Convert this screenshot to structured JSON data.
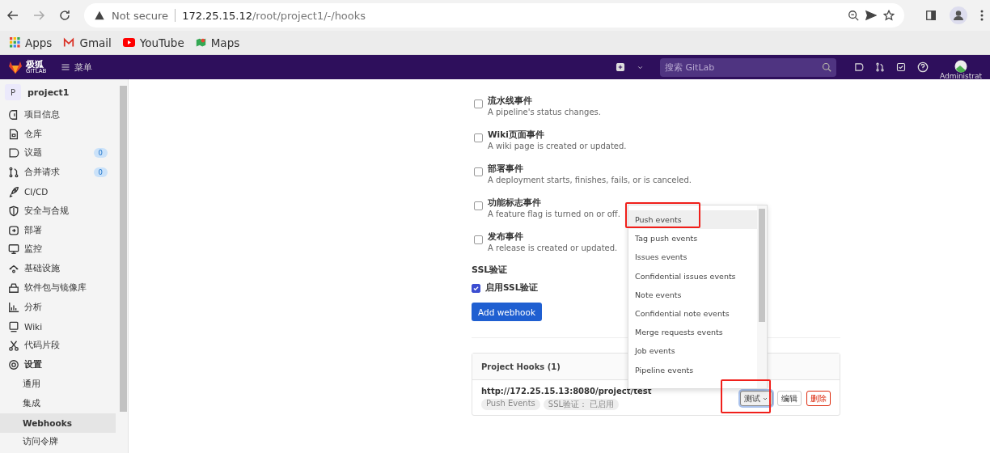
{
  "browser": {
    "security": "Not secure",
    "url_host": "172.25.15.12",
    "url_path": "/root/project1/-/hooks",
    "bookmarks": [
      "Apps",
      "Gmail",
      "YouTube",
      "Maps"
    ]
  },
  "header": {
    "brand": "极狐",
    "brand_sub": "GITLAB",
    "menu": "菜单",
    "search_placeholder": "搜索 GitLab",
    "user": "Administrat"
  },
  "sidebar": {
    "project": {
      "avatar": "P",
      "name": "project1"
    },
    "items": [
      {
        "label": "项目信息",
        "selected": false
      },
      {
        "label": "仓库",
        "selected": false
      },
      {
        "label": "议题",
        "count": "0",
        "selected": false
      },
      {
        "label": "合并请求",
        "count": "0",
        "selected": false
      },
      {
        "label": "CI/CD",
        "selected": false
      },
      {
        "label": "安全与合规",
        "selected": false
      },
      {
        "label": "部署",
        "selected": false
      },
      {
        "label": "监控",
        "selected": false
      },
      {
        "label": "基础设施",
        "selected": false
      },
      {
        "label": "软件包与镜像库",
        "selected": false
      },
      {
        "label": "分析",
        "selected": false
      },
      {
        "label": "Wiki",
        "selected": false
      },
      {
        "label": "代码片段",
        "selected": false
      },
      {
        "label": "设置",
        "selected": false,
        "expanded": true,
        "children": [
          {
            "label": "通用",
            "selected": false
          },
          {
            "label": "集成",
            "selected": false
          },
          {
            "label": "Webhooks",
            "selected": true
          },
          {
            "label": "访问令牌",
            "selected": false
          }
        ]
      }
    ]
  },
  "events": [
    {
      "title": "流水线事件",
      "description": "A pipeline's status changes.",
      "checked": false
    },
    {
      "title": "Wiki页面事件",
      "description": "A wiki page is created or updated.",
      "checked": false
    },
    {
      "title": "部署事件",
      "description": "A deployment starts, finishes, fails, or is canceled.",
      "checked": false
    },
    {
      "title": "功能标志事件",
      "description": "A feature flag is turned on or off.",
      "checked": false
    },
    {
      "title": "发布事件",
      "description": "A release is created or updated.",
      "checked": false
    }
  ],
  "ssl": {
    "heading": "SSL验证",
    "label": "启用SSL验证",
    "checked": true
  },
  "add_button": "Add webhook",
  "hooks": {
    "title": "Project Hooks (1)",
    "items": [
      {
        "url": "http://172.25.15.13:8080/project/test",
        "tags": [
          "Push Events",
          "SSL验证： 已启用"
        ],
        "test_button": "测试",
        "edit_button": "编辑",
        "delete_button": "删除"
      }
    ]
  },
  "test_menu": {
    "items": [
      {
        "label": "Push events",
        "selected": true
      },
      {
        "label": "Tag push events",
        "selected": false
      },
      {
        "label": "Issues events",
        "selected": false
      },
      {
        "label": "Confidential issues events",
        "selected": false
      },
      {
        "label": "Note events",
        "selected": false
      },
      {
        "label": "Confidential note events",
        "selected": false
      },
      {
        "label": "Merge requests events",
        "selected": false
      },
      {
        "label": "Job events",
        "selected": false
      },
      {
        "label": "Pipeline events",
        "selected": false
      }
    ]
  }
}
